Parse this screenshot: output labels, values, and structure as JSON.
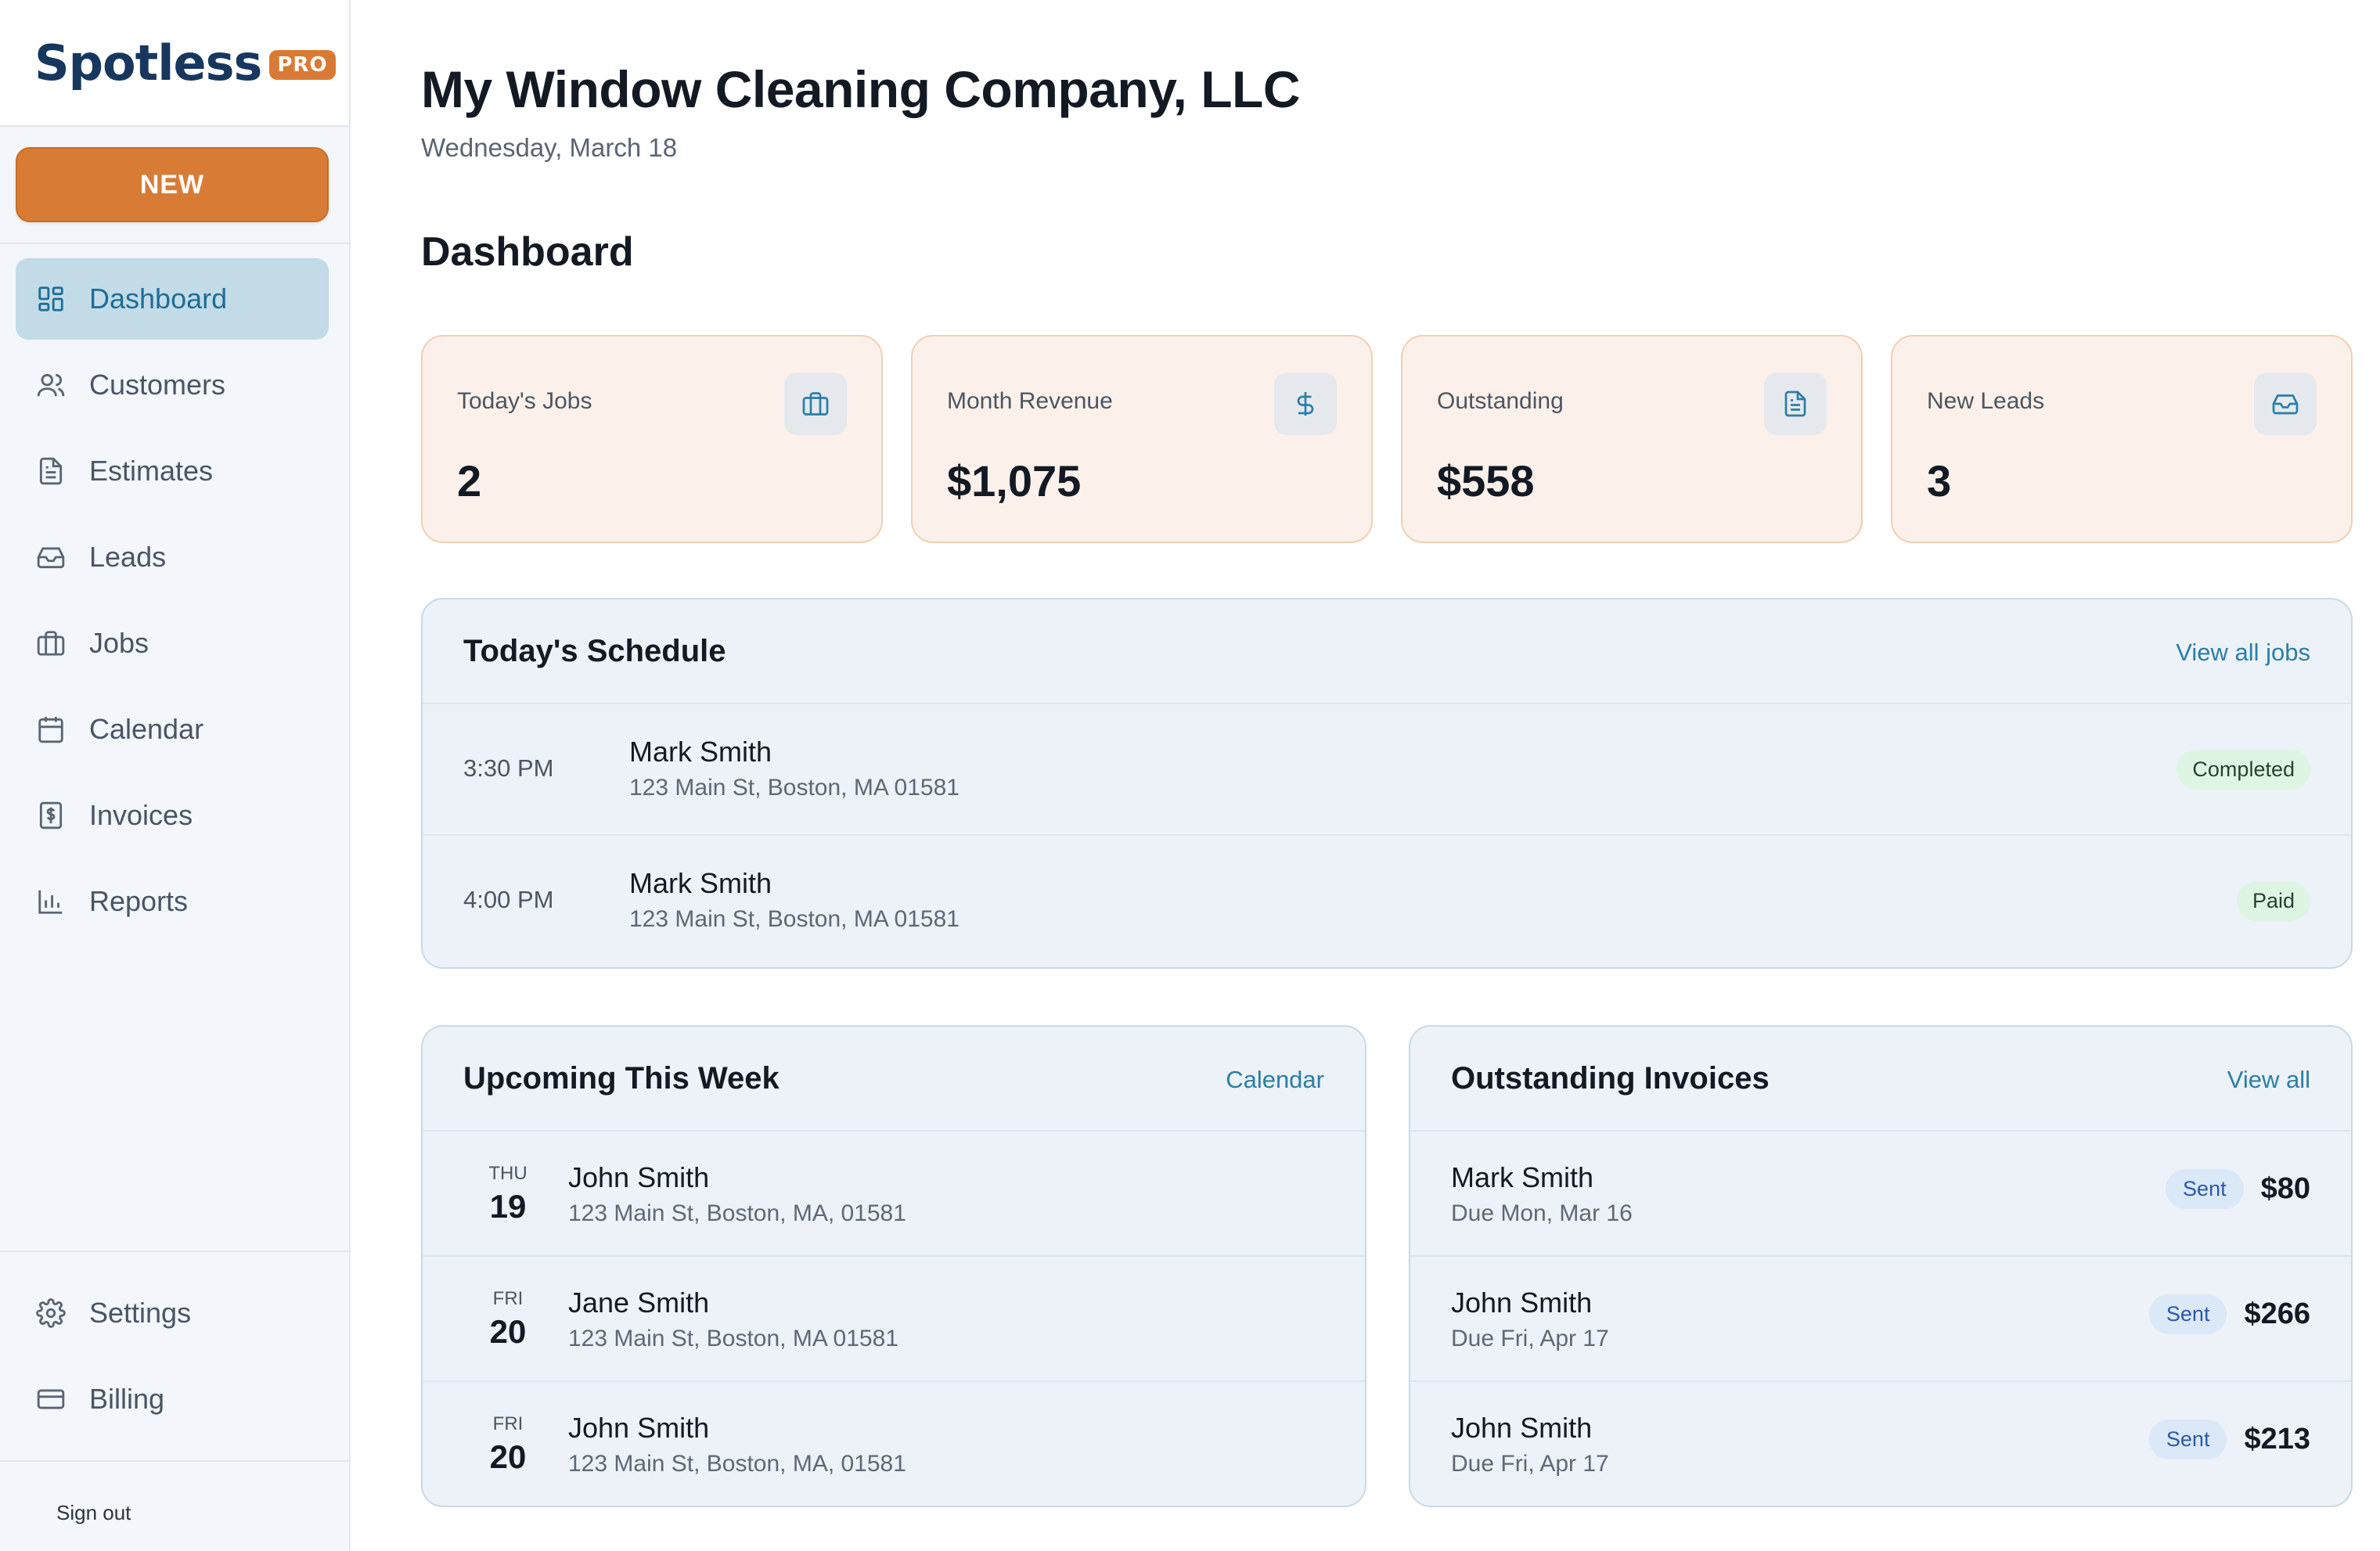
{
  "brand": {
    "name": "Spotless",
    "badge": "PRO",
    "primary_color": "#17375e",
    "accent_color": "#d87b35"
  },
  "sidebar": {
    "new_label": "NEW",
    "items": [
      {
        "label": "Dashboard",
        "icon": "dashboard-icon",
        "active": true
      },
      {
        "label": "Customers",
        "icon": "users-icon"
      },
      {
        "label": "Estimates",
        "icon": "document-icon"
      },
      {
        "label": "Leads",
        "icon": "inbox-icon"
      },
      {
        "label": "Jobs",
        "icon": "briefcase-icon"
      },
      {
        "label": "Calendar",
        "icon": "calendar-icon"
      },
      {
        "label": "Invoices",
        "icon": "receipt-icon"
      },
      {
        "label": "Reports",
        "icon": "bar-chart-icon"
      }
    ],
    "bottom_items": [
      {
        "label": "Settings",
        "icon": "gear-icon"
      },
      {
        "label": "Billing",
        "icon": "credit-card-icon"
      }
    ],
    "sign_out": "Sign out"
  },
  "header": {
    "company": "My Window Cleaning Company, LLC",
    "date": "Wednesday, March 18",
    "page_title": "Dashboard"
  },
  "stats": [
    {
      "label": "Today's Jobs",
      "value": "2",
      "icon": "briefcase-icon"
    },
    {
      "label": "Month Revenue",
      "value": "$1,075",
      "icon": "dollar-icon"
    },
    {
      "label": "Outstanding",
      "value": "$558",
      "icon": "document-icon"
    },
    {
      "label": "New Leads",
      "value": "3",
      "icon": "inbox-icon"
    }
  ],
  "schedule": {
    "title": "Today's Schedule",
    "link": "View all jobs",
    "rows": [
      {
        "time": "3:30 PM",
        "name": "Mark Smith",
        "address": "123 Main St, Boston, MA 01581",
        "status": "Completed"
      },
      {
        "time": "4:00 PM",
        "name": "Mark Smith",
        "address": "123 Main St, Boston, MA 01581",
        "status": "Paid"
      }
    ]
  },
  "upcoming": {
    "title": "Upcoming This Week",
    "link": "Calendar",
    "rows": [
      {
        "dow": "THU",
        "day": "19",
        "name": "John Smith",
        "address": "123 Main St, Boston, MA, 01581"
      },
      {
        "dow": "FRI",
        "day": "20",
        "name": "Jane Smith",
        "address": "123 Main St, Boston, MA 01581"
      },
      {
        "dow": "FRI",
        "day": "20",
        "name": "John Smith",
        "address": "123 Main St, Boston, MA, 01581"
      }
    ]
  },
  "invoices": {
    "title": "Outstanding Invoices",
    "link": "View all",
    "rows": [
      {
        "name": "Mark Smith",
        "due": "Due Mon, Mar 16",
        "status": "Sent",
        "amount": "$80"
      },
      {
        "name": "John Smith",
        "due": "Due Fri, Apr 17",
        "status": "Sent",
        "amount": "$266"
      },
      {
        "name": "John Smith",
        "due": "Due Fri, Apr 17",
        "status": "Sent",
        "amount": "$213"
      }
    ]
  }
}
